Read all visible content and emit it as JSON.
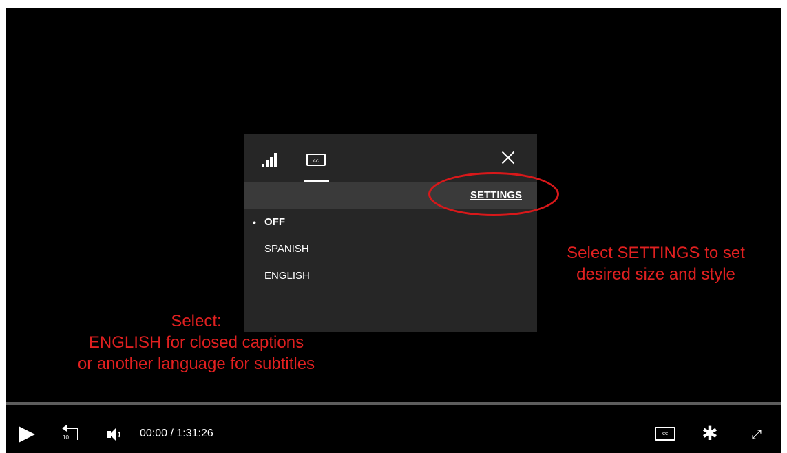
{
  "panel": {
    "cc_tab_label": "cc",
    "settings_label": "SETTINGS",
    "languages": [
      {
        "label": "OFF",
        "selected": true
      },
      {
        "label": "SPANISH",
        "selected": false
      },
      {
        "label": "ENGLISH",
        "selected": false
      }
    ],
    "selected_bullet": "•"
  },
  "annotations": {
    "right_line1": "Select SETTINGS to set",
    "right_line2": "desired size and style",
    "left_line1": "Select:",
    "left_line2": "ENGLISH for closed captions",
    "left_line3": "or another language for subtitles",
    "color": "#e02020"
  },
  "controls": {
    "rewind_seconds": "10",
    "time_current": "00:00",
    "time_separator": "/",
    "time_total": "1:31:26",
    "cc_label": "cc",
    "gear_glyph": "✱",
    "fullscreen_glyph": "⤢"
  },
  "icons": {
    "play": "play-icon",
    "rewind": "rewind-10-icon",
    "volume": "volume-icon",
    "signal": "signal-bars-icon",
    "close": "close-icon",
    "settings": "gear-icon",
    "fullscreen": "fullscreen-icon"
  }
}
